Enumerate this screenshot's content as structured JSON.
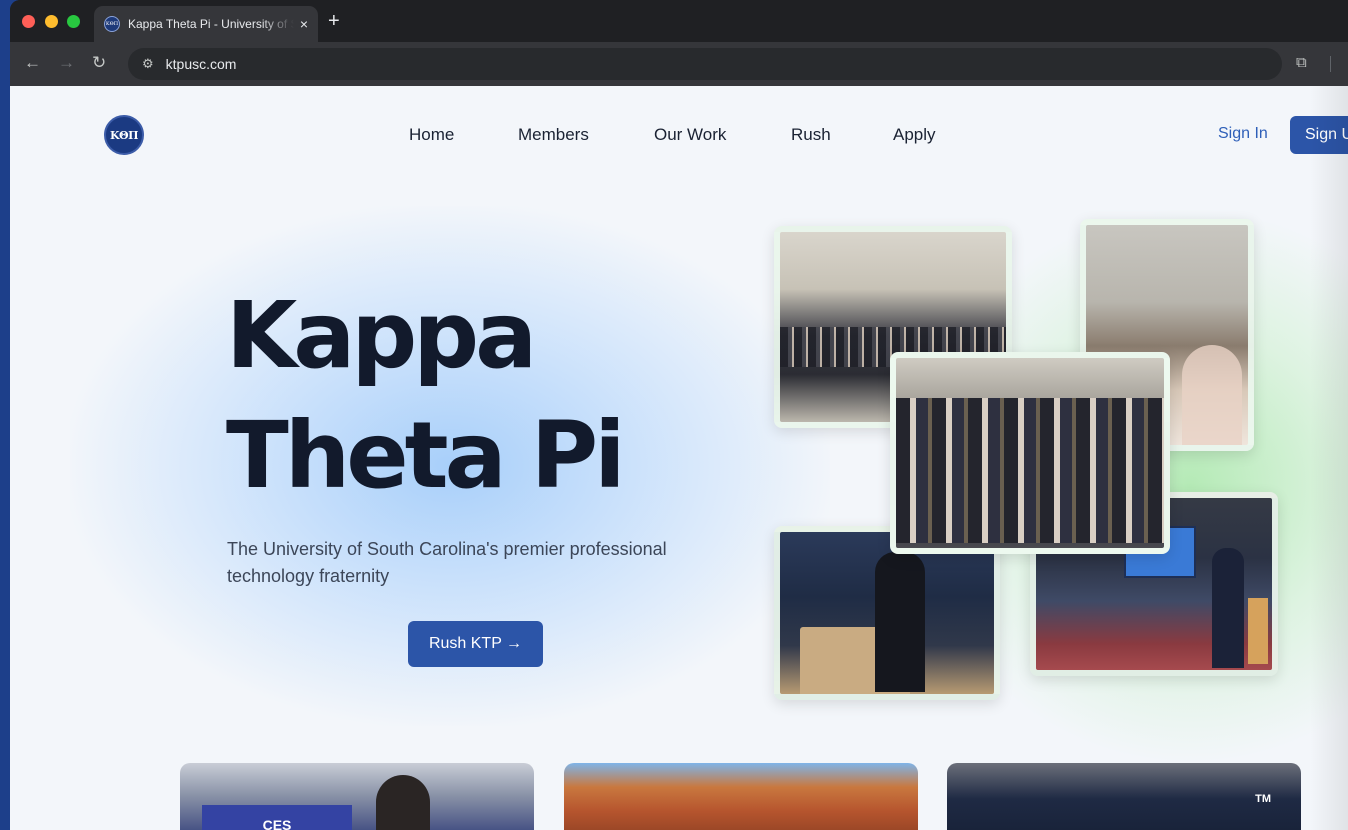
{
  "browser": {
    "tab_title": "Kappa Theta Pi - University of South Carolina",
    "tab_close": "×",
    "new_tab": "+",
    "url": "ktpusc.com",
    "favicon_text": "ΚΘΠ"
  },
  "nav": {
    "logo_text": "ΚΘΠ",
    "links": [
      "Home",
      "Members",
      "Our Work",
      "Rush",
      "Apply"
    ],
    "sign_in": "Sign In",
    "sign_up": "Sign Up"
  },
  "hero": {
    "title_line1": "Kappa",
    "title_line2": "Theta Pi",
    "subtitle": "The University of South Carolina's premier professional technology fraternity",
    "cta": "Rush KTP →"
  },
  "cards": {
    "ces_label": "CES",
    "tm_label": "TM"
  },
  "colors": {
    "brand_blue": "#2c55a8",
    "heading": "#121a2c",
    "glow_blue": "#a4cdfa",
    "glow_green": "#aae8aa"
  }
}
